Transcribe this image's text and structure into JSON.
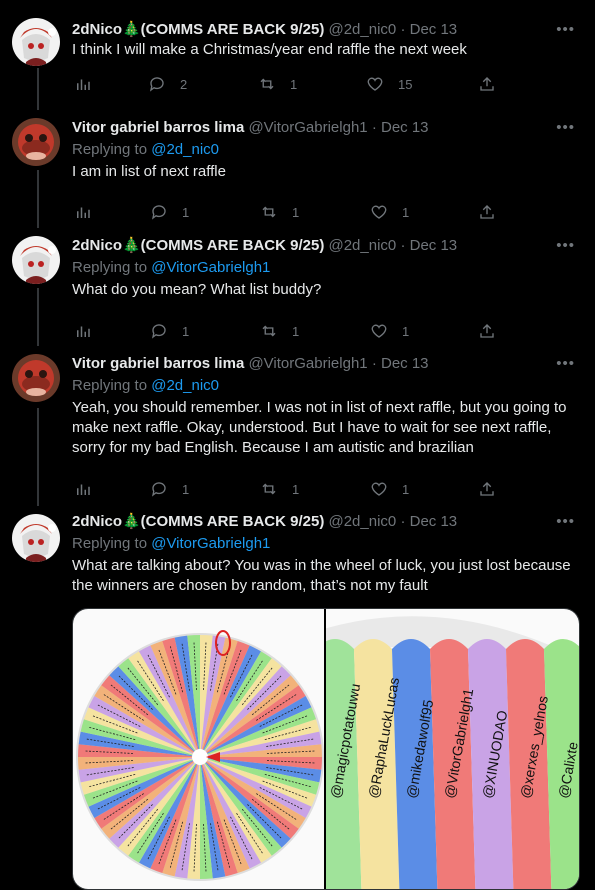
{
  "tweets": [
    {
      "name": "2dNico🎄(COMMS ARE BACK 9/25)",
      "handle": "@2d_nic0",
      "date": "Dec 13",
      "replying_label": "",
      "replying_to": "",
      "text": "I think I will make a Christmas/year end raffle the next week",
      "counts": {
        "replies": "2",
        "retweets": "1",
        "likes": "15"
      }
    },
    {
      "name": "Vitor gabriel barros lima",
      "handle": "@VitorGabrielgh1",
      "date": "Dec 13",
      "replying_label": "Replying to",
      "replying_to": "@2d_nic0",
      "text": "I am in list of next raffle",
      "counts": {
        "replies": "1",
        "retweets": "1",
        "likes": "1"
      }
    },
    {
      "name": "2dNico🎄(COMMS ARE BACK 9/25)",
      "handle": "@2d_nic0",
      "date": "Dec 13",
      "replying_label": "Replying to",
      "replying_to": "@VitorGabrielgh1",
      "text": "What do you mean? What list buddy?",
      "counts": {
        "replies": "1",
        "retweets": "1",
        "likes": "1"
      }
    },
    {
      "name": "Vitor gabriel barros lima",
      "handle": "@VitorGabrielgh1",
      "date": "Dec 13",
      "replying_label": "Replying to",
      "replying_to": "@2d_nic0",
      "text": "Yeah, you should remember. I was not in list of next raffle, but you going to make next raffle. Okay, understood. But I have to wait for see next raffle, sorry for my bad English. Because I am autistic and brazilian",
      "counts": {
        "replies": "1",
        "retweets": "1",
        "likes": "1"
      }
    },
    {
      "name": "2dNico🎄(COMMS ARE BACK 9/25)",
      "handle": "@2d_nic0",
      "date": "Dec 13",
      "replying_label": "Replying to",
      "replying_to": "@VitorGabrielgh1",
      "text": "What are talking about? You was in the wheel of luck, you just lost because the winners are chosen by random, that’s not my fault"
    }
  ],
  "separator": "·",
  "media": {
    "wheel_names": [
      "@magicpotatouwu",
      "@RaphaLuckLucas",
      "@mikedawolf95",
      "@VitorGabrielgh1",
      "@XINUODAO",
      "@xerxes_yelnos",
      "@Calixte"
    ]
  },
  "icons": {
    "analytics": "analytics-icon",
    "reply": "reply-icon",
    "retweet": "retweet-icon",
    "like": "like-icon",
    "share": "share-icon",
    "more": "more-icon"
  },
  "colors": {
    "background": "#000000",
    "text": "#e7e9ea",
    "muted": "#71767b",
    "link": "#1d9bf0",
    "wheel": [
      "#f07a78",
      "#5b8de6",
      "#9be38a",
      "#f5e3a0",
      "#c9a3e6",
      "#f2b27a"
    ]
  }
}
